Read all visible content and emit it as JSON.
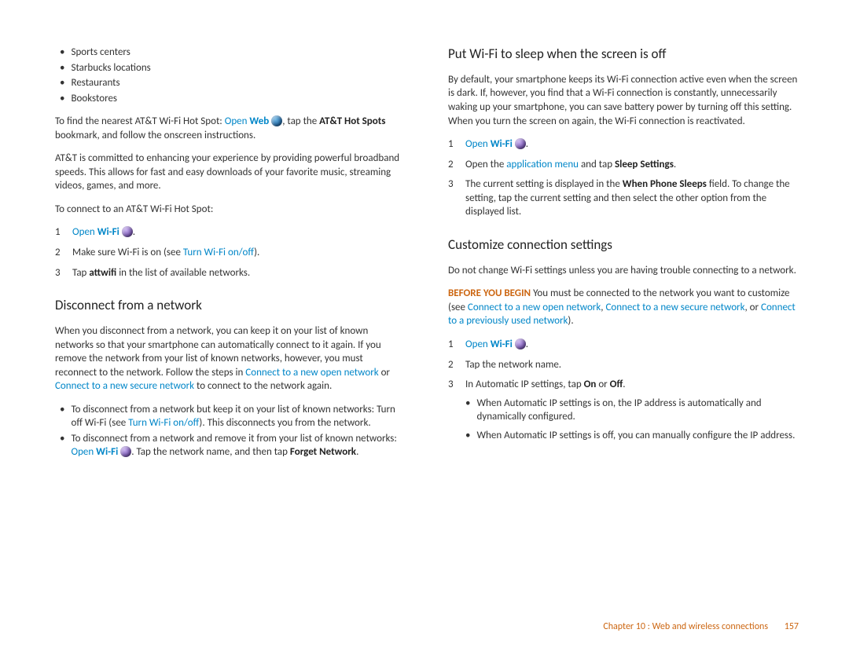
{
  "left": {
    "bullets": [
      "Sports centers",
      "Starbucks locations",
      "Restaurants",
      "Bookstores"
    ],
    "p1a": "To find the nearest AT&T Wi-Fi Hot Spot: ",
    "p1_open": "Open ",
    "p1_web": "Web",
    "p1b": ", tap the ",
    "p1_att": "AT&T Hot Spots",
    "p1c": " bookmark, and follow the onscreen instructions.",
    "p2": "AT&T is committed to enhancing your experience by providing powerful broadband speeds. This allows for fast and easy downloads of your favorite music, streaming videos, games, and more.",
    "p3": "To connect to an AT&T Wi-Fi Hot Spot:",
    "s1_open": "Open ",
    "s1_wifi": "Wi-Fi",
    "s1_dot": ".",
    "s2a": "Make sure Wi-Fi is on (see ",
    "s2_link": "Turn Wi-Fi on/off",
    "s2b": ").",
    "s3a": "Tap ",
    "s3_att": "attwifi",
    "s3b": " in the list of available networks.",
    "h_disconnect": "Disconnect from a network",
    "d_p1a": "When you disconnect from a network, you can keep it on your list of known networks so that your smartphone can automatically connect to it again. If you remove the network from your list of known networks, however, you must reconnect to the network. Follow the steps in ",
    "d_link1": "Connect to a new open network",
    "d_or": " or ",
    "d_link2": "Connect to a new secure network",
    "d_p1b": " to connect to the network again.",
    "d_b1a": "To disconnect from a network but keep it on your list of known networks: Turn off Wi-Fi (see ",
    "d_b1_link": "Turn Wi-Fi on/off",
    "d_b1b": "). This disconnects you from the network.",
    "d_b2a": "To disconnect from a network and remove it from your list of known networks: ",
    "d_b2_open": "Open ",
    "d_b2_wifi": "Wi-Fi",
    "d_b2b": ". Tap the network name, and then tap ",
    "d_b2_forget": "Forget Network",
    "d_b2c": "."
  },
  "right": {
    "h_sleep": "Put Wi-Fi to sleep when the screen is off",
    "sl_p1": "By default, your smartphone keeps its Wi-Fi connection active even when the screen is dark. If, however, you find that a Wi-Fi connection is constantly, unnecessarily waking up your smartphone, you can save battery power by turning off this setting. When you turn the screen on again, the Wi-Fi connection is reactivated.",
    "sl_s1_open": "Open ",
    "sl_s1_wifi": "Wi-Fi",
    "sl_s1_dot": ".",
    "sl_s2a": "Open the ",
    "sl_s2_link": "application menu",
    "sl_s2b": " and tap ",
    "sl_s2_bold": "Sleep Settings",
    "sl_s2c": ".",
    "sl_s3a": "The current setting is displayed in the ",
    "sl_s3_bold": "When Phone Sleeps",
    "sl_s3b": " field. To change the setting, tap the current setting and then select the other option from the displayed list.",
    "h_custom": "Customize connection settings",
    "c_p1": "Do not change Wi-Fi settings unless you are having trouble connecting to a network.",
    "c_before": "BEFORE YOU BEGIN",
    "c_p2a": " You must be connected to the network you want to customize (see ",
    "c_link1": "Connect to a new open network",
    "c_sep1": ", ",
    "c_link2": "Connect to a new secure network",
    "c_sep2": ", or ",
    "c_link3": "Connect to a previously used network",
    "c_p2b": ").",
    "c_s1_open": "Open ",
    "c_s1_wifi": "Wi-Fi",
    "c_s1_dot": ".",
    "c_s2": "Tap the network name.",
    "c_s3a": "In Automatic IP settings, tap ",
    "c_s3_on": "On",
    "c_s3_or": " or ",
    "c_s3_off": "Off",
    "c_s3b": ".",
    "c_sub1": "When Automatic IP settings is on, the IP address is automatically and dynamically configured.",
    "c_sub2": "When Automatic IP settings is off, you can manually configure the IP address."
  },
  "footer": {
    "chapter": "Chapter 10 : Web and wireless connections",
    "page": "157"
  }
}
